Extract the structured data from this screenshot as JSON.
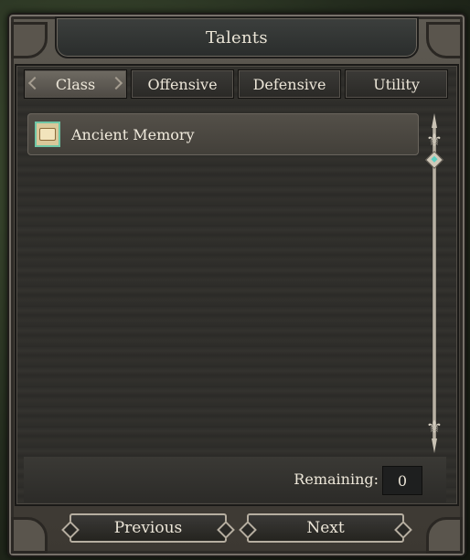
{
  "window": {
    "title": "Talents"
  },
  "tabs": [
    {
      "label": "Class",
      "active": true
    },
    {
      "label": "Offensive",
      "active": false
    },
    {
      "label": "Defensive",
      "active": false
    },
    {
      "label": "Utility",
      "active": false
    }
  ],
  "talents": [
    {
      "label": "Ancient Memory",
      "icon": "scroll-icon"
    }
  ],
  "remaining": {
    "label": "Remaining:",
    "value": "0"
  },
  "buttons": {
    "previous": "Previous",
    "next": "Next"
  },
  "colors": {
    "accent": "#5ad0c2",
    "frame": "#5e5a52",
    "text": "#ece6d8"
  }
}
